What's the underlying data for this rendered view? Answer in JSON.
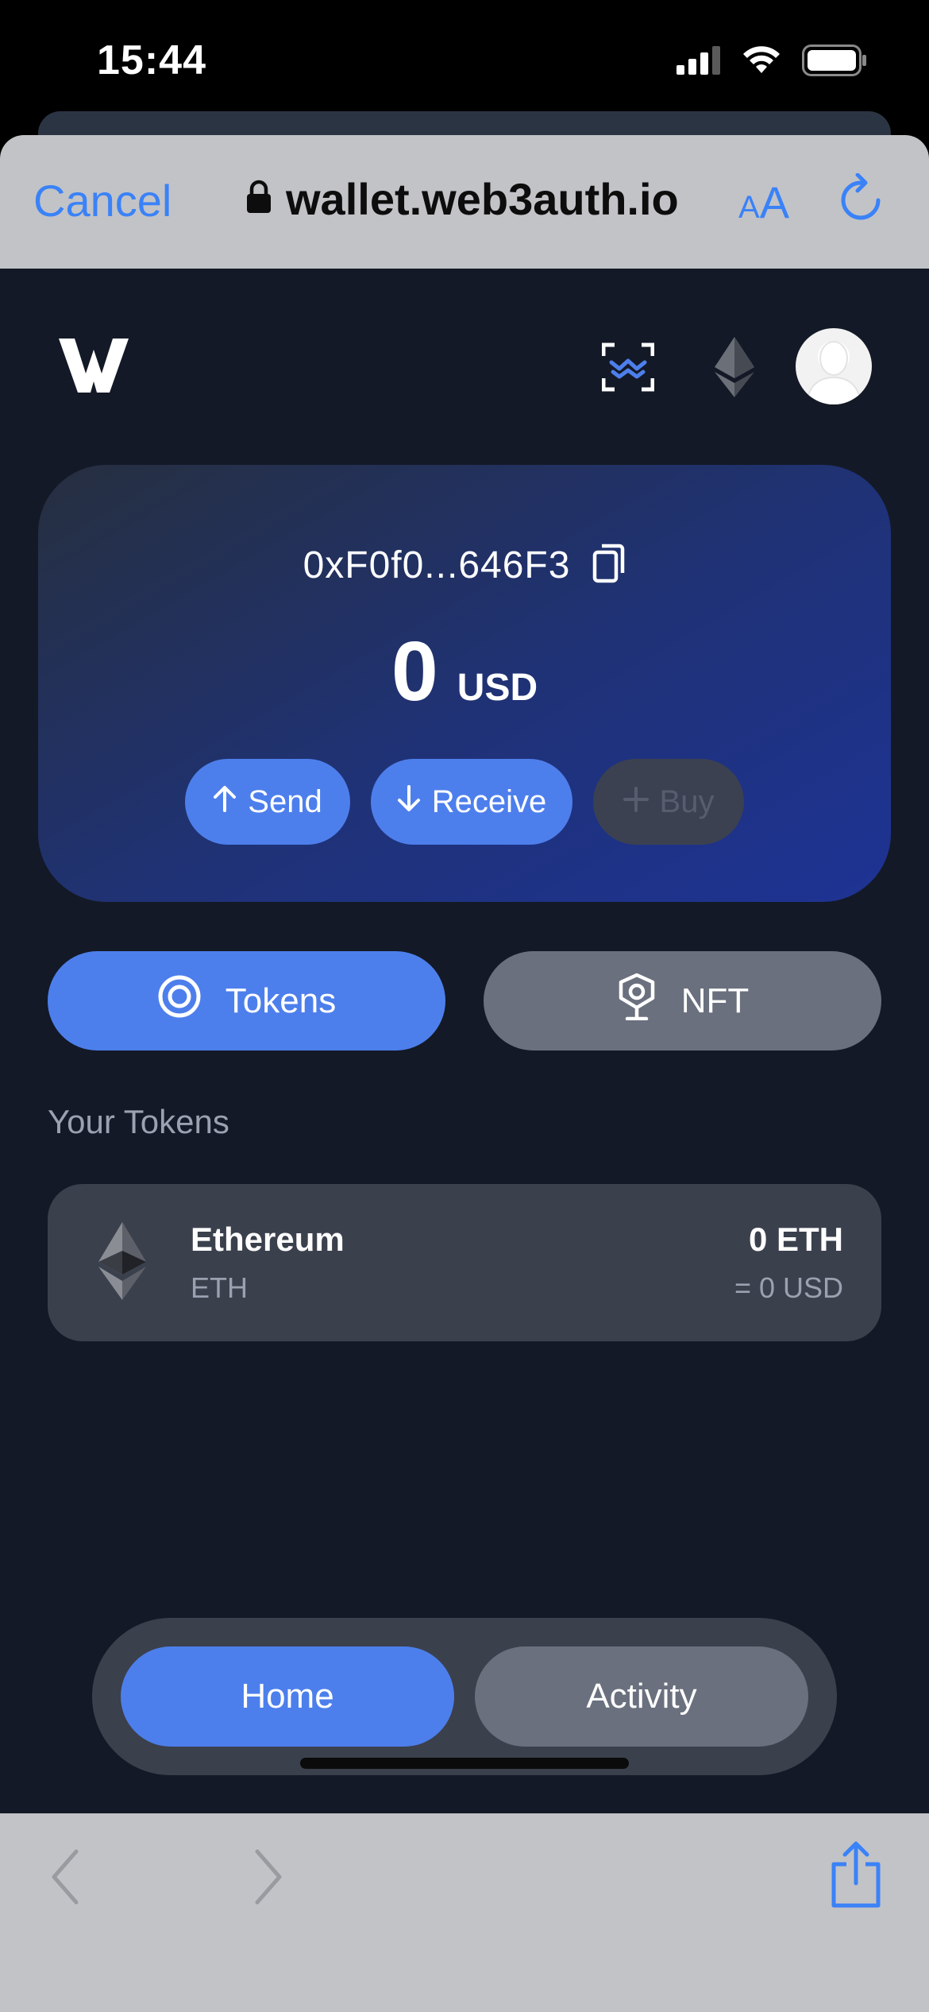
{
  "status_bar": {
    "time": "15:44",
    "icons": [
      "cellular-signal-icon",
      "wifi-icon",
      "battery-icon"
    ]
  },
  "browser": {
    "cancel_label": "Cancel",
    "url": "wallet.web3auth.io",
    "text_size_label_small": "A",
    "text_size_label_large": "A",
    "icons": [
      "lock-icon",
      "reload-icon",
      "back-arrow-icon",
      "forward-arrow-icon",
      "share-icon"
    ]
  },
  "header": {
    "icons": [
      "web3auth-logo",
      "walletconnect-scan-icon",
      "ethereum-network-icon",
      "avatar"
    ]
  },
  "wallet": {
    "address": "0xF0f0...646F3",
    "balance": "0",
    "currency": "USD",
    "actions": {
      "send": "Send",
      "receive": "Receive",
      "buy": "Buy"
    }
  },
  "tabs": {
    "tokens": "Tokens",
    "nft": "NFT"
  },
  "tokens_section": {
    "title": "Your Tokens",
    "items": [
      {
        "name": "Ethereum",
        "symbol": "ETH",
        "amount": "0 ETH",
        "usd_value": "= 0 USD"
      }
    ]
  },
  "bottom_nav": {
    "home": "Home",
    "activity": "Activity"
  },
  "colors": {
    "accent": "#4d7fec",
    "app_background": "#141927",
    "card_background": "#3b404d",
    "safari_blue": "#3a82f7"
  }
}
